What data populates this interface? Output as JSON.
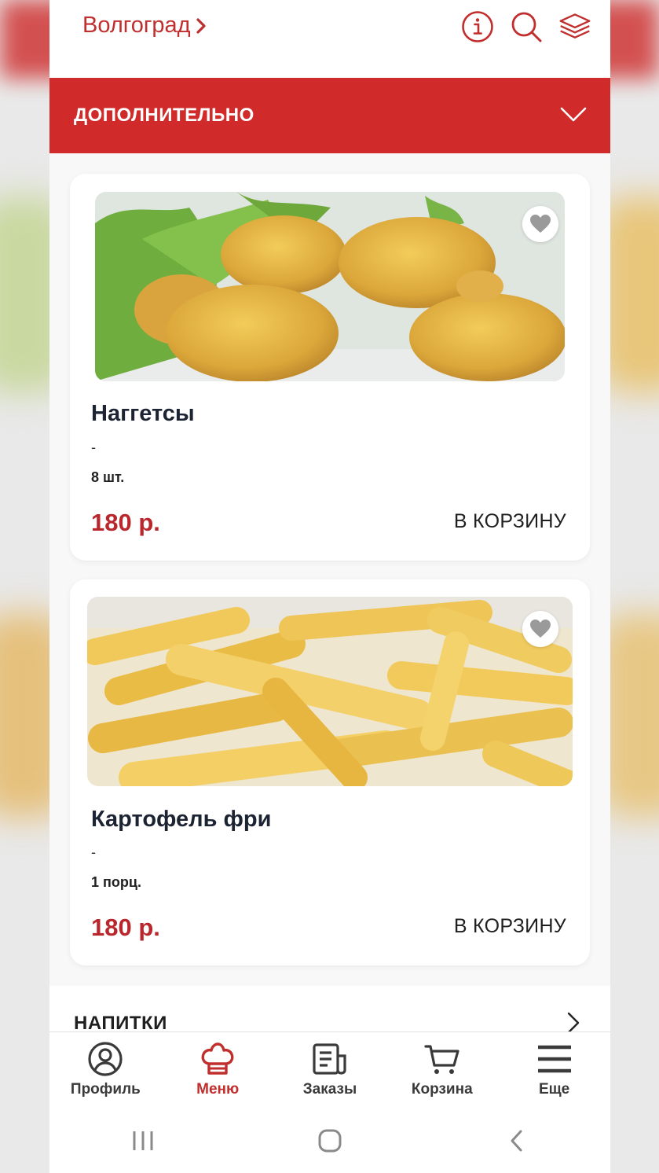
{
  "header": {
    "city": "Волгоград"
  },
  "section": {
    "title": "ДОПОЛНИТЕЛЬНО"
  },
  "products": [
    {
      "name": "Наггетсы",
      "description": "-",
      "portion": "8 шт.",
      "price": "180 р.",
      "cart_label": "В КОРЗИНУ",
      "favorite": false
    },
    {
      "name": "Картофель фри",
      "description": "-",
      "portion": "1 порц.",
      "price": "180 р.",
      "cart_label": "В КОРЗИНУ",
      "favorite": false
    }
  ],
  "next_section": {
    "title": "НАПИТКИ"
  },
  "tabbar": {
    "items": [
      {
        "label": "Профиль",
        "icon": "user-circle-icon",
        "active": false
      },
      {
        "label": "Меню",
        "icon": "chef-hat-icon",
        "active": true
      },
      {
        "label": "Заказы",
        "icon": "receipt-icon",
        "active": false
      },
      {
        "label": "Корзина",
        "icon": "cart-icon",
        "active": false
      },
      {
        "label": "Еще",
        "icon": "menu-lines-icon",
        "active": false
      }
    ]
  },
  "colors": {
    "accent": "#c12e2e",
    "section_bar": "#d12a2a",
    "price": "#b9262b"
  }
}
